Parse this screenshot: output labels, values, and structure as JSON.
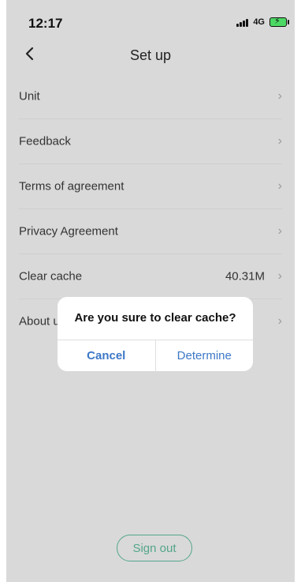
{
  "status_bar": {
    "time": "12:17",
    "network": "4G",
    "battery_color": "#4cd964"
  },
  "header": {
    "back_icon": "chevron-left-icon",
    "title": "Set up"
  },
  "settings": {
    "items": [
      {
        "label": "Unit",
        "value": ""
      },
      {
        "label": "Feedback",
        "value": ""
      },
      {
        "label": "Terms of agreement",
        "value": ""
      },
      {
        "label": "Privacy Agreement",
        "value": ""
      },
      {
        "label": "Clear cache",
        "value": "40.31M"
      },
      {
        "label": "About us",
        "value": ""
      }
    ],
    "chevron_icon": "chevron-right-icon"
  },
  "dialog": {
    "message": "Are you sure to clear cache?",
    "cancel_label": "Cancel",
    "confirm_label": "Determine",
    "button_color": "#3d78c7"
  },
  "footer": {
    "signout_label": "Sign out",
    "accent_color": "#53a58b"
  }
}
